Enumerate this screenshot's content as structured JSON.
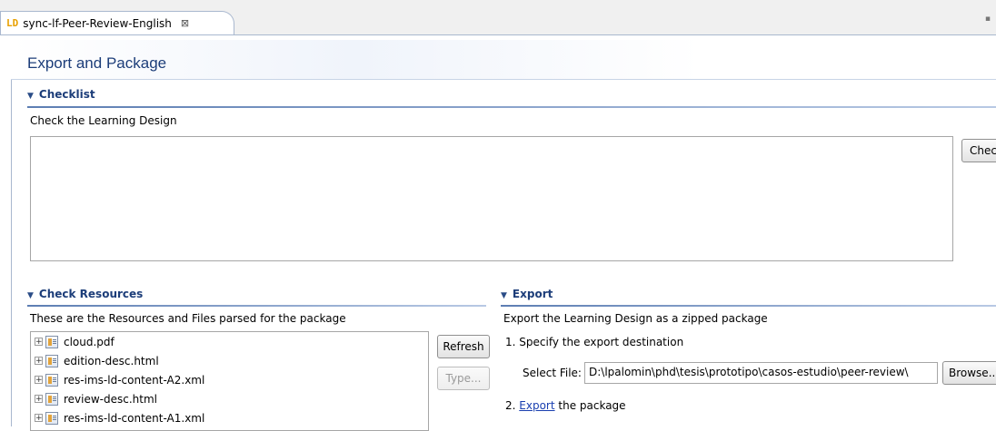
{
  "tab": {
    "icon_label": "LD",
    "title": "sync-lf-Peer-Review-English",
    "close_glyph": "⊠"
  },
  "page": {
    "title": "Export and Package"
  },
  "checklist": {
    "header": "Checklist",
    "description": "Check the Learning Design",
    "check_button": "Chec"
  },
  "resources": {
    "header": "Check Resources",
    "description": "These are the Resources and Files parsed for the package",
    "refresh_button": "Refresh",
    "type_button": "Type...",
    "items": [
      {
        "label": "cloud.pdf",
        "icon": "file-icon"
      },
      {
        "label": "edition-desc.html",
        "icon": "file-icon"
      },
      {
        "label": "res-ims-ld-content-A2.xml",
        "icon": "file-icon"
      },
      {
        "label": "review-desc.html",
        "icon": "file-icon"
      },
      {
        "label": "res-ims-ld-content-A1.xml",
        "icon": "file-icon"
      }
    ]
  },
  "export": {
    "header": "Export",
    "description": "Export the Learning Design as a zipped package",
    "step1": "1.  Specify the export destination",
    "select_file_label": "Select File:",
    "select_file_value": "D:\\lpalomin\\phd\\tesis\\prototipo\\casos-estudio\\peer-review\\",
    "browse_button": "Browse...",
    "step2_prefix": "2.",
    "step2_link": "Export",
    "step2_suffix": "the package"
  }
}
